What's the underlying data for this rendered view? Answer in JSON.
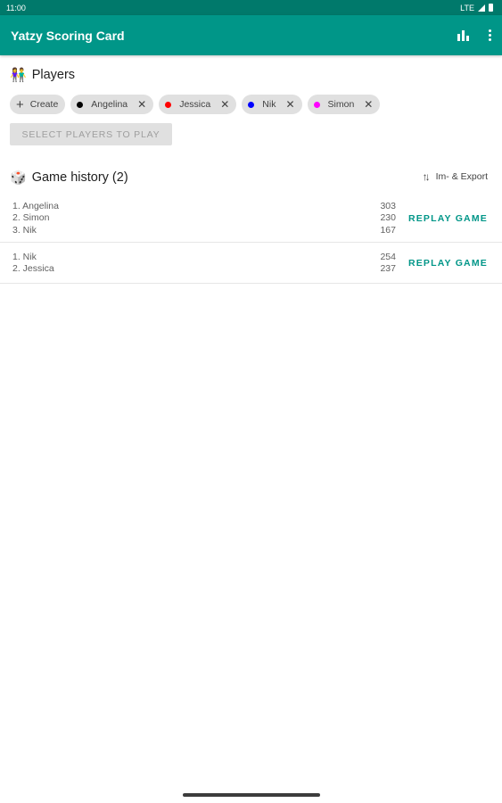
{
  "status_bar": {
    "time": "11:00",
    "network": "LTE"
  },
  "app_bar": {
    "title": "Yatzy Scoring Card",
    "stats_icon": "bar-chart-icon",
    "menu_icon": "more-vert-icon"
  },
  "players": {
    "emoji": "👫",
    "title": "Players",
    "create_label": "Create",
    "chips": [
      {
        "name": "Angelina",
        "color": "#000000"
      },
      {
        "name": "Jessica",
        "color": "#ff0000"
      },
      {
        "name": "Nik",
        "color": "#0000ff"
      },
      {
        "name": "Simon",
        "color": "#ff00ff"
      }
    ],
    "select_button": "SELECT PLAYERS TO PLAY"
  },
  "history": {
    "emoji": "🎲",
    "title": "Game history (2)",
    "export_label": "Im- & Export",
    "games": [
      {
        "names": [
          "1. Angelina",
          "2. Simon",
          "3. Nik"
        ],
        "scores": [
          "303",
          "230",
          "167"
        ],
        "action": "REPLAY GAME"
      },
      {
        "names": [
          "1. Nik",
          "2. Jessica"
        ],
        "scores": [
          "254",
          "237"
        ],
        "action": "REPLAY GAME"
      }
    ]
  },
  "colors": {
    "primary": "#009688",
    "primary_dark": "#00796b"
  }
}
